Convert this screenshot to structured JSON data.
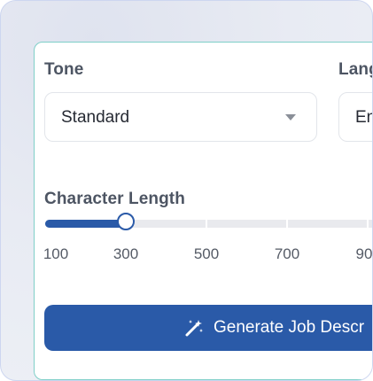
{
  "tone": {
    "label": "Tone",
    "value": "Standard"
  },
  "language": {
    "label": "Lang",
    "value": "En"
  },
  "length": {
    "label": "Character Length",
    "ticks": [
      "100",
      "300",
      "500",
      "700",
      "90"
    ],
    "value_fraction": 0.25
  },
  "generate": {
    "label": "Generate Job Descr"
  },
  "colors": {
    "accent": "#2a5aa8",
    "card_border": "#7fcfc8"
  },
  "icons": {
    "select_caret": "chevron-down-icon",
    "generate": "magic-wand-icon"
  }
}
